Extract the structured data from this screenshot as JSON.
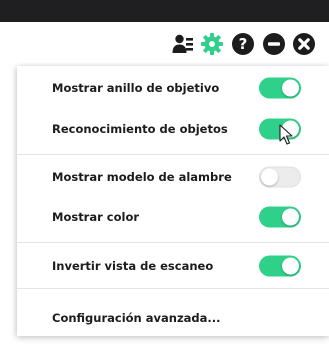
{
  "colors": {
    "top_bar": "#1f1f21",
    "toolbar_icon": "#1c1c1e",
    "gear_icon": "#2fd08a",
    "toggle_on": "#2fd08a",
    "toggle_off": "#ececec"
  },
  "toolbar": {
    "icons": [
      "user-list-icon",
      "gear-icon",
      "help-icon",
      "minimize-icon",
      "close-icon"
    ]
  },
  "settings": {
    "items": [
      {
        "label": "Mostrar anillo de objetivo",
        "enabled": true
      },
      {
        "label": "Reconocimiento de objetos",
        "enabled": true
      },
      {
        "label": "Mostrar modelo de alambre",
        "enabled": false
      },
      {
        "label": "Mostrar color",
        "enabled": true
      },
      {
        "label": "Invertir vista de escaneo",
        "enabled": true
      }
    ],
    "advanced_label": "Configuración avanzada..."
  }
}
